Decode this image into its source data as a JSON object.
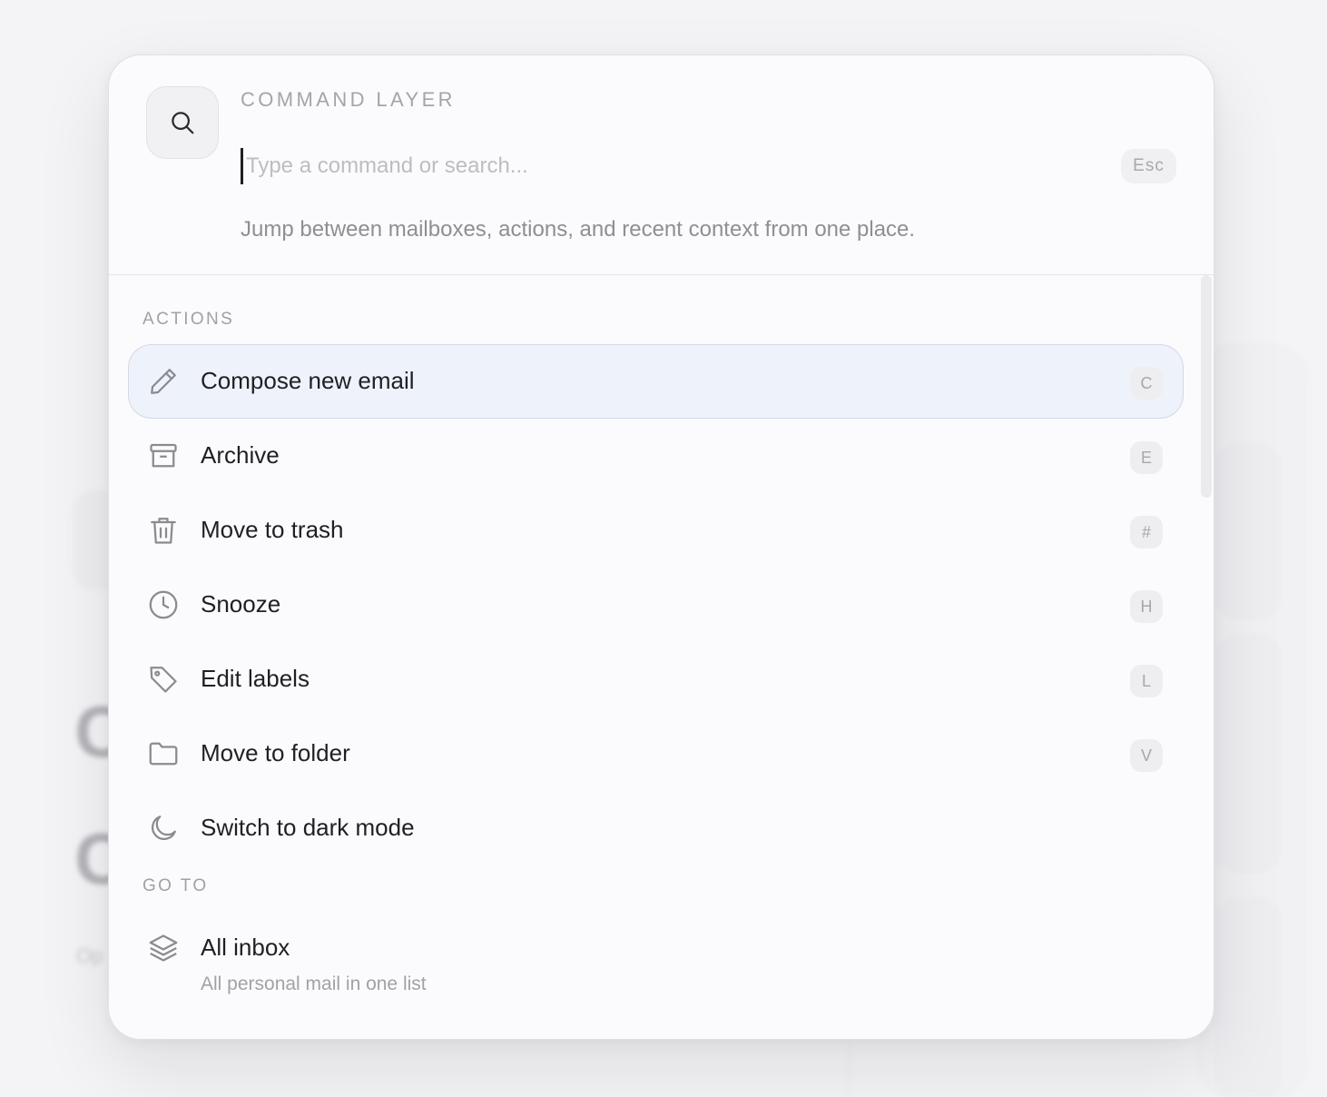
{
  "palette": {
    "title": "COMMAND LAYER",
    "input": {
      "value": "",
      "placeholder": "Type a command or search..."
    },
    "esc_label": "Esc",
    "hint": "Jump between mailboxes, actions, and recent context from one place."
  },
  "sections": [
    {
      "label": "ACTIONS",
      "items": [
        {
          "label": "Compose new email",
          "shortcut": "C",
          "icon": "pencil-icon",
          "selected": true
        },
        {
          "label": "Archive",
          "shortcut": "E",
          "icon": "archive-box-icon"
        },
        {
          "label": "Move to trash",
          "shortcut": "#",
          "icon": "trash-icon"
        },
        {
          "label": "Snooze",
          "shortcut": "H",
          "icon": "clock-icon"
        },
        {
          "label": "Edit labels",
          "shortcut": "L",
          "icon": "tag-icon"
        },
        {
          "label": "Move to folder",
          "shortcut": "V",
          "icon": "folder-icon"
        },
        {
          "label": "Switch to dark mode",
          "shortcut": "",
          "icon": "moon-icon"
        }
      ]
    },
    {
      "label": "GO TO",
      "items": [
        {
          "label": "All inbox",
          "subtitle": "All personal mail in one list",
          "icon": "layers-icon"
        }
      ]
    }
  ],
  "colors": {
    "selected_bg": "#eef2fa",
    "icon_stroke": "#8a8a90",
    "text": "#1f2024"
  }
}
